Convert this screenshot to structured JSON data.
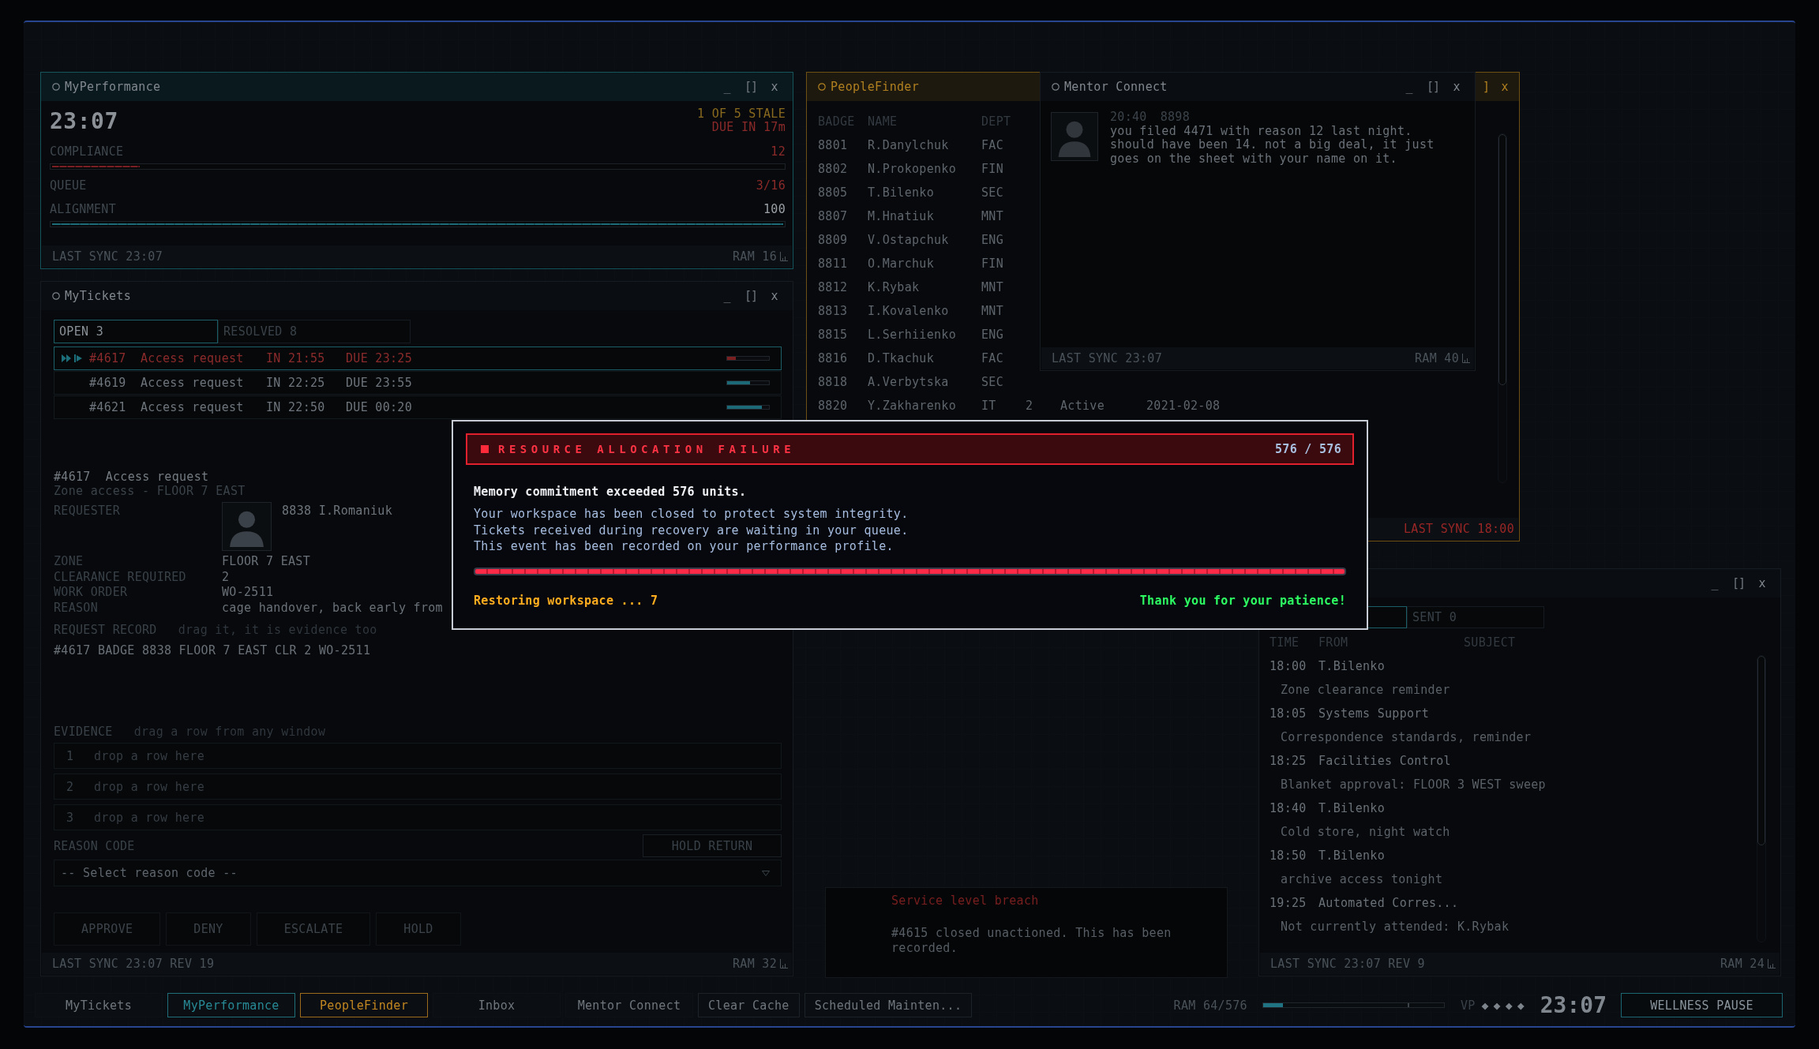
{
  "windows": [
    {
      "kind": "performance",
      "title": "MyPerformance",
      "color": "#16545b",
      "controls": [
        {
          "kind": "minimize",
          "label": "_"
        },
        {
          "kind": "maximize",
          "label": "[]"
        },
        {
          "kind": "close",
          "label": "x"
        }
      ],
      "clock": "23:07",
      "alerts": [
        {
          "kind": "warning",
          "text": "1 OF 5 STALE"
        },
        {
          "kind": "danger",
          "text": "DUE IN 17m"
        }
      ],
      "metrics": [
        {
          "label": "COMPLIANCE",
          "value": "12",
          "alert": true,
          "level": 0.12
        },
        {
          "label": "QUEUE",
          "value": "3/16",
          "alert": true
        },
        {
          "label": "ALIGNMENT",
          "value": "100",
          "alert": false,
          "level": 1
        }
      ],
      "footer": {
        "sync": "LAST SYNC 23:07",
        "ram": "RAM 16",
        "stale": false
      }
    },
    {
      "kind": "tickets",
      "title": "MyTickets",
      "controls": [
        {
          "kind": "minimize",
          "label": "_"
        },
        {
          "kind": "maximize",
          "label": "[]"
        },
        {
          "kind": "close",
          "label": "x"
        }
      ],
      "tabs": [
        {
          "label": "OPEN 3",
          "selected": true
        },
        {
          "label": "RESOLVED 8",
          "selected": false
        }
      ],
      "tickets": [
        {
          "id": "#4617",
          "type": "Access request",
          "received": "IN 21:55",
          "due": "DUE 23:25",
          "selected": true,
          "urgent": true,
          "level": 0.2
        },
        {
          "id": "#4619",
          "type": "Access request",
          "received": "IN 22:25",
          "due": "DUE 23:55",
          "selected": false,
          "urgent": false,
          "level": 0.55
        },
        {
          "id": "#4621",
          "type": "Access request",
          "received": "IN 22:50",
          "due": "DUE 00:20",
          "selected": false,
          "urgent": false,
          "level": 0.83
        }
      ],
      "detail": {
        "id": "#4617",
        "title": "Access request",
        "subtitle": "Zone access - FLOOR 7 EAST",
        "requester_label": "REQUESTER",
        "requester": "8838 I.Romaniuk",
        "fields": [
          {
            "label": "ZONE",
            "value": "FLOOR 7 EAST"
          },
          {
            "label": "CLEARANCE REQUIRED",
            "value": "2"
          },
          {
            "label": "WORK ORDER",
            "value": "WO-2511"
          },
          {
            "label": "REASON",
            "value": "cage handover, back early from"
          }
        ],
        "record_label": "REQUEST RECORD",
        "record_hint": "drag it, it is evidence too",
        "record": "#4617 BADGE 8838 FLOOR 7 EAST CLR 2 WO-2511",
        "evidence_label": "EVIDENCE",
        "evidence_hint": "drag a row from any window",
        "evidence_slots": [
          {
            "number": "1",
            "hint": "drop a row here"
          },
          {
            "number": "2",
            "hint": "drop a row here"
          },
          {
            "number": "3",
            "hint": "drop a row here"
          }
        ],
        "reason_label": "REASON CODE",
        "hold_return": "HOLD RETURN",
        "reason_select": {
          "placeholder": "-- Select reason code --"
        },
        "actions": [
          {
            "label": "APPROVE",
            "disabled": true
          },
          {
            "label": "DENY",
            "disabled": true
          },
          {
            "label": "ESCALATE",
            "disabled": true
          },
          {
            "label": "HOLD",
            "disabled": true
          }
        ]
      },
      "footer": {
        "sync": "LAST SYNC 23:07 REV 19",
        "ram": "RAM 32",
        "stale": false
      }
    },
    {
      "kind": "people",
      "title": "PeopleFinder",
      "color": "#6e5014",
      "controls": [
        {
          "kind": "maximize",
          "label": "]"
        },
        {
          "kind": "close",
          "label": "x"
        }
      ],
      "table": {
        "columns": [
          "BADGE",
          "NAME",
          "DEPT"
        ],
        "rows": [
          [
            "8801",
            "R.Danylchuk",
            "FAC"
          ],
          [
            "8802",
            "N.Prokopenko",
            "FIN"
          ],
          [
            "8805",
            "T.Bilenko",
            "SEC"
          ],
          [
            "8807",
            "M.Hnatiuk",
            "MNT"
          ],
          [
            "8809",
            "V.Ostapchuk",
            "ENG"
          ],
          [
            "8811",
            "O.Marchuk",
            "FIN"
          ],
          [
            "8812",
            "K.Rybak",
            "MNT"
          ],
          [
            "8813",
            "I.Kovalenko",
            "MNT"
          ],
          [
            "8815",
            "L.Serhiienko",
            "ENG"
          ],
          [
            "8816",
            "D.Tkachuk",
            "FAC"
          ],
          [
            "8818",
            "A.Verbytska",
            "SEC"
          ],
          [
            "8820",
            "Y.Zakharenko",
            "IT",
            "2",
            "Active",
            "2021-02-08"
          ]
        ]
      },
      "footer": {
        "sync": "LAST SYNC 18:00",
        "stale": true
      }
    },
    {
      "kind": "mentor",
      "title": "Mentor Connect",
      "controls": [
        {
          "kind": "minimize",
          "label": "_"
        },
        {
          "kind": "maximize",
          "label": "[]"
        },
        {
          "kind": "close",
          "label": "x"
        }
      ],
      "messages": [
        {
          "time": "20:40",
          "sender": "8898",
          "text": "you filed 4471 with reason 12 last night. should have been 14. not a big deal, it just goes on the sheet with your name on it."
        }
      ],
      "footer": {
        "sync": "LAST SYNC 23:07",
        "ram": "RAM 40",
        "stale": false
      }
    },
    {
      "kind": "inbox",
      "controls": [
        {
          "kind": "minimize",
          "label": "_"
        },
        {
          "kind": "maximize",
          "label": "[]"
        },
        {
          "kind": "close",
          "label": "x"
        }
      ],
      "tabs": [
        {
          "selected": true
        },
        {
          "label": "SENT 0",
          "selected": false
        }
      ],
      "columns": [
        "TIME",
        "FROM",
        "SUBJECT"
      ],
      "messages": [
        {
          "time": "18:00",
          "from": "T.Bilenko",
          "subject": "Zone clearance reminder"
        },
        {
          "time": "18:05",
          "from": "Systems Support",
          "subject": "Correspondence standards, reminder"
        },
        {
          "time": "18:25",
          "from": "Facilities Control",
          "subject": "Blanket approval: FLOOR 3 WEST sweep"
        },
        {
          "time": "18:40",
          "from": "T.Bilenko",
          "subject": "Cold store, night watch"
        },
        {
          "time": "18:50",
          "from": "T.Bilenko",
          "subject": "archive access tonight"
        },
        {
          "time": "19:25",
          "from": "Automated Corres...",
          "subject": "Not currently attended: K.Rybak"
        }
      ],
      "footer": {
        "sync": "LAST SYNC 23:07 REV 9",
        "ram": "RAM 24",
        "stale": false
      }
    }
  ],
  "notice": {
    "title": "Service level breach",
    "text": "#4615 closed unactioned. This has been recorded."
  },
  "dialog": {
    "title": "RESOURCE ALLOCATION FAILURE",
    "counter": "576 / 576",
    "headline": "Memory commitment exceeded 576 units.",
    "lines": [
      "Your workspace has been closed to protect system integrity.",
      "Tickets received during recovery are waiting in your queue.",
      "This event has been recorded on your performance profile."
    ],
    "level": 1,
    "status": "Restoring workspace ... 7",
    "thanks": "Thank you for your patience!"
  },
  "taskbar": {
    "items": [
      {
        "label": "MyTickets",
        "kind": "window"
      },
      {
        "label": "MyPerformance",
        "kind": "window",
        "color": "#1f6e78"
      },
      {
        "label": "PeopleFinder",
        "kind": "window",
        "color": "#9c6c1a"
      },
      {
        "label": "Inbox",
        "kind": "window"
      },
      {
        "label": "Mentor Connect",
        "kind": "window"
      },
      {
        "label": "Clear Cache",
        "kind": "action"
      },
      {
        "label": "Scheduled Mainten...",
        "kind": "action"
      }
    ],
    "ram": {
      "label": "RAM 64/576",
      "level": 0.11
    },
    "vp": {
      "label": "VP",
      "rating": "◆◆◆◆"
    },
    "clock": "23:07",
    "pause": "WELLNESS PAUSE"
  }
}
